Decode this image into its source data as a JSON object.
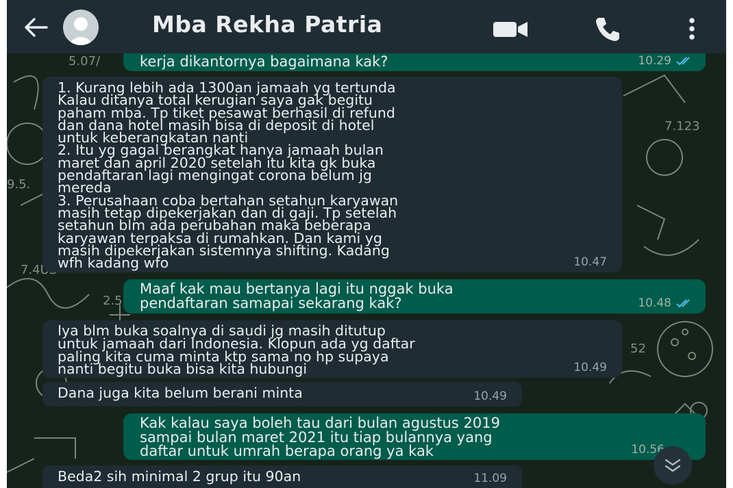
{
  "header": {
    "contact_name": "Mba Rekha Patria",
    "icons": [
      "back-arrow-icon",
      "avatar",
      "video-call-icon",
      "voice-call-icon",
      "menu-dots-icon"
    ]
  },
  "messages": [
    {
      "direction": "outgoing",
      "text": "kerja dikantornya bagaimana kak?",
      "time": "10.29",
      "status": "read"
    },
    {
      "direction": "incoming",
      "text": "1. Kurang lebih ada 1300an jamaah yg tertunda\nKalau ditanya total kerugian saya gak begitu\npaham mba. Tp tiket pesawat berhasil di refund\ndan dana hotel masih bisa di deposit di hotel\nuntuk keberangkatan nanti\n2. Itu yg gagal berangkat hanya jamaah bulan\nmaret dan april 2020 setelah itu kita gk buka\npendaftaran lagi mengingat corona belum jg\nmereda\n3. Perusahaan coba bertahan setahun karyawan\nmasih tetap dipekerjakan dan di gaji. Tp setelah\nsetahun blm ada perubahan maka beberapa\nkaryawan terpaksa di rumahkan. Dan kami yg\nmasih dipekerjakan sistemnya shifting. Kadang\nwfh kadang wfo",
      "time": "10.47"
    },
    {
      "direction": "outgoing",
      "text": "Maaf kak mau bertanya lagi itu nggak buka\npendaftaran samapai sekarang kak?",
      "time": "10.48",
      "status": "read"
    },
    {
      "direction": "incoming",
      "text": "Iya blm buka soalnya di saudi jg masih ditutup\nuntuk jamaah dari Indonesia. Klopun ada yg daftar\npaling kita cuma minta ktp sama no hp supaya\nnanti begitu buka bisa kita hubungi",
      "time": "10.49"
    },
    {
      "direction": "incoming",
      "text": "Dana juga kita belum berani minta",
      "time": "10.49"
    },
    {
      "direction": "outgoing",
      "text": "Kak kalau saya boleh tau dari bulan agustus 2019\nsampai bulan maret 2021 itu tiap bulannya yang\ndaftar untuk umrah berapa orang ya kak",
      "time": "10.56",
      "status": "read"
    },
    {
      "direction": "incoming",
      "text": "Beda2 sih minimal 2 grup itu 90an",
      "time": "11.09"
    }
  ],
  "colors": {
    "header_bg": "#1f2c34",
    "incoming_bubble": "#202c33",
    "outgoing_bubble": "#005c4b",
    "read_ticks": "#53bdeb",
    "wallpaper": "#17231a"
  },
  "scroll_button_icon": "double-chevron-down-icon"
}
